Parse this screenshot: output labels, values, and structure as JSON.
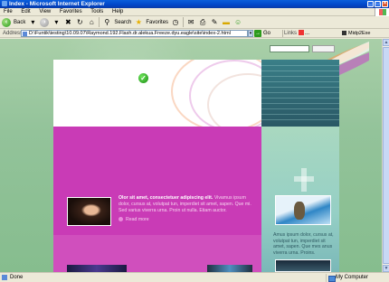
{
  "window": {
    "title": "Index - Microsoft Internet Explorer"
  },
  "menu": {
    "items": [
      "File",
      "Edit",
      "View",
      "Favorites",
      "Tools",
      "Help"
    ]
  },
  "toolbar": {
    "back_label": "Back",
    "search_label": "Search",
    "favorites_label": "Favorites"
  },
  "address": {
    "label": "Address",
    "value": "D:\\Funtik\\testing\\10.09.07\\Raymond.192.Flash.dr.alekua.Freeze.dyu.eagle\\site\\index-2.html",
    "go_label": "Go",
    "links_label": "Links",
    "links_button": "...",
    "emulator_label": "Midp2Exe Emulator"
  },
  "content": {
    "article_lead": "Olor sit amet, consectetuer adipiscing elit.",
    "article_rest": "Vivamus ipsum dolor, cursus at, volutpat tun, imperdiet sit amet, sapen. Que mi. Sed varius viverra urna. Proin ut nulla. Etiam auctor.",
    "read_more": "Read more",
    "side_text": "Amus ipsum dolor, cursus at, volutpat tun, imperdiet sit amet, sapen. Que mes anus viverra urna. Proins."
  },
  "status": {
    "text": "Done",
    "zone": "My Computer"
  },
  "colors": {
    "page_bg": "#9ec6a2",
    "pink": "#c93bb6",
    "teal": "#2a5865",
    "titlebar": "#0046c8"
  }
}
